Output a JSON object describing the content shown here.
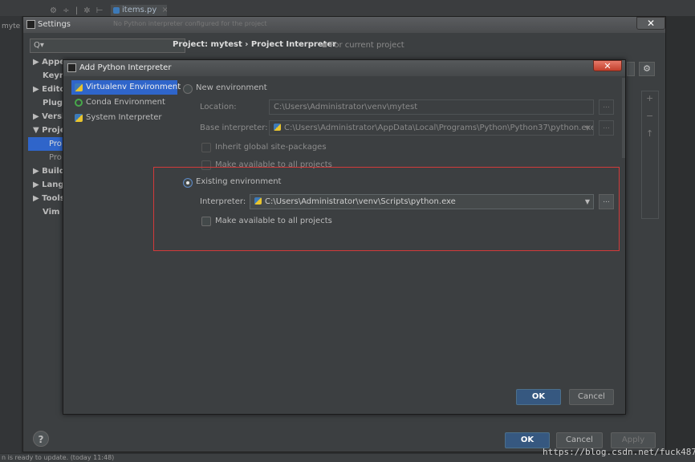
{
  "ide": {
    "tab_label": "items.py",
    "tab_close": "×",
    "left_text": "myte",
    "toolbar_glyphs": "⚙ ÷ | ✲ ⊢",
    "status_text": "n is ready to update. (today 11:48)",
    "watermark": "https://blog.csdn.net/fuck487"
  },
  "settings": {
    "title": "Settings",
    "close_label": "✕",
    "search_placeholder": "Q▾",
    "banner_text": "No Python interpreter configured for the project",
    "breadcrumb": "Project: mytest  ›  Project Interpreter",
    "breadcrumb_note": "For current project",
    "sidebar": [
      {
        "label": "▶ Appe",
        "kind": "group"
      },
      {
        "label": "Keym",
        "kind": "plain"
      },
      {
        "label": "▶ Edito",
        "kind": "group"
      },
      {
        "label": "Plugi",
        "kind": "plain"
      },
      {
        "label": "▶ Versi",
        "kind": "group"
      },
      {
        "label": "▼ Proje",
        "kind": "group"
      },
      {
        "label": "Pro",
        "kind": "selected"
      },
      {
        "label": "Pro",
        "kind": "sub"
      },
      {
        "label": "▶ Build,",
        "kind": "group"
      },
      {
        "label": "▶ Langu",
        "kind": "group"
      },
      {
        "label": "▶ Tools",
        "kind": "group"
      },
      {
        "label": "Vim E",
        "kind": "plain"
      }
    ],
    "right_plus": "+",
    "right_minus": "−",
    "right_up": "↑",
    "help": "?",
    "ok": "OK",
    "cancel": "Cancel",
    "apply": "Apply",
    "gear": "⚙"
  },
  "dialog": {
    "title": "Add Python Interpreter",
    "close_label": "✕",
    "sidebar": [
      {
        "label": "Virtualenv Environment",
        "icon": "virtualenv-icon",
        "selected": true
      },
      {
        "label": "Conda Environment",
        "icon": "conda-icon",
        "selected": false
      },
      {
        "label": "System Interpreter",
        "icon": "python-icon",
        "selected": false
      }
    ],
    "new_env": {
      "label": "New environment",
      "selected": false,
      "location_label": "Location:",
      "location_value": "C:\\Users\\Administrator\\venv\\mytest",
      "base_label": "Base interpreter:",
      "base_value": "C:\\Users\\Administrator\\AppData\\Local\\Programs\\Python\\Python37\\python.exe",
      "inherit_label": "Inherit global site-packages",
      "make_available_label": "Make available to all projects"
    },
    "existing_env": {
      "label": "Existing environment",
      "selected": true,
      "interpreter_label": "Interpreter:",
      "interpreter_value": "C:\\Users\\Administrator\\venv\\Scripts\\python.exe",
      "make_available_label": "Make available to all projects"
    },
    "browse": "...",
    "dropdown": "▼",
    "ok": "OK",
    "cancel": "Cancel"
  },
  "colors": {
    "accent": "#2f65ca",
    "primary_button": "#365880",
    "highlight_box": "#d23a3a"
  }
}
